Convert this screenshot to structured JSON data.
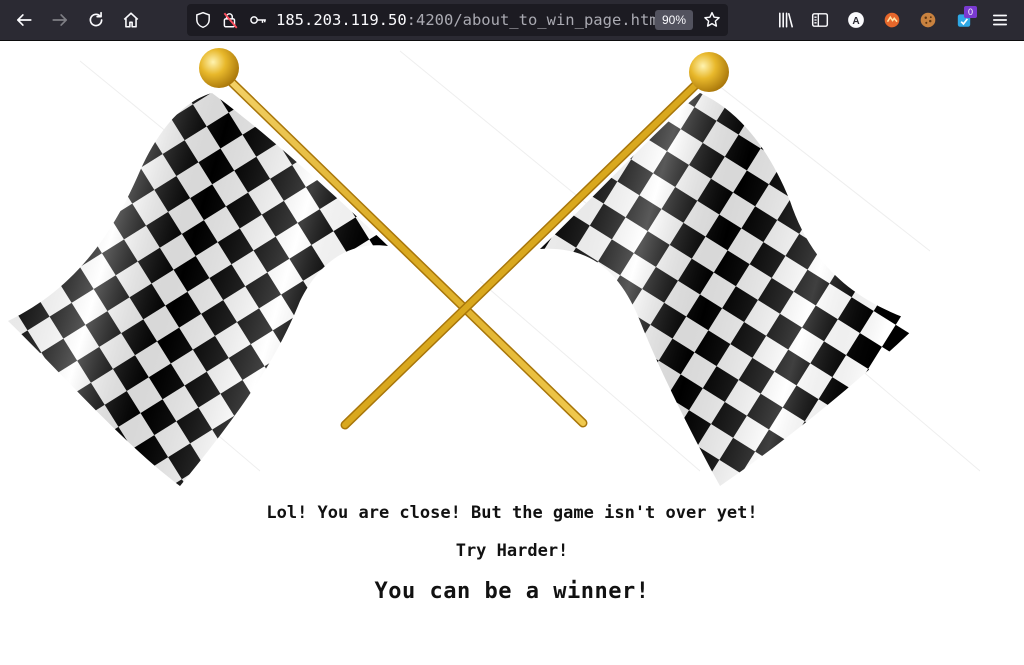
{
  "browser": {
    "url_host": "185.203.119.50",
    "url_rest": ":4200/about_to_win_page.htm",
    "zoom": "90%",
    "extension_badge": "0",
    "icons": [
      "back-icon",
      "forward-icon",
      "reload-icon",
      "home-icon",
      "shield-icon",
      "lock-warning-icon",
      "key-icon",
      "bookmark-star-icon",
      "library-icon",
      "sidebar-icon",
      "account-icon",
      "extension-icon",
      "cookie-icon",
      "extension-icon",
      "menu-icon"
    ]
  },
  "page": {
    "message1": "Lol! You are close! But the game isn't over yet!",
    "message2": "Try Harder!",
    "message3": "You can be a winner!",
    "image": "crossed-checkered-flags"
  }
}
